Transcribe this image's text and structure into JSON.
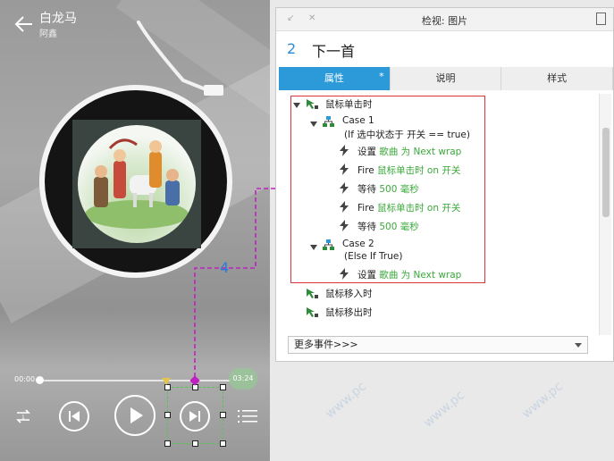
{
  "player": {
    "song_title": "白龙马",
    "artist": "阿鑫",
    "time_current": "00:00",
    "time_total": "03:24",
    "progress": 0.0
  },
  "annotation": {
    "step_number": "4"
  },
  "inspector": {
    "window_title": "检视: 图片",
    "item_number": "2",
    "item_name": "下一首",
    "tabs": [
      {
        "label": "属性",
        "marker": "*"
      },
      {
        "label": "说明"
      },
      {
        "label": "样式"
      }
    ],
    "events": {
      "onclick": "鼠标单击时",
      "case1_title": "Case 1",
      "case1_condition": "(If 选中状态于 开关 == true)",
      "case1_actions": [
        {
          "verb": "设置",
          "target": "歌曲 为 Next wrap"
        },
        {
          "verb": "Fire",
          "target": "鼠标单击时 on 开关"
        },
        {
          "verb": "等待",
          "target": "500 毫秒"
        },
        {
          "verb": "Fire",
          "target": "鼠标单击时 on 开关"
        },
        {
          "verb": "等待",
          "target": "500 毫秒"
        }
      ],
      "case2_title": "Case 2",
      "case2_condition": "(Else If True)",
      "case2_actions": [
        {
          "verb": "设置",
          "target": "歌曲 为 Next wrap"
        }
      ],
      "onmouseenter": "鼠标移入时",
      "onmouseleave": "鼠标移出时"
    },
    "more_events": "更多事件>>>"
  },
  "colors": {
    "accent": "#2c9ad8",
    "highlight_border": "#d9363e",
    "action_green": "#3aa83a",
    "connector_purple": "#c020c0",
    "number_blue": "#2b7bd4"
  }
}
